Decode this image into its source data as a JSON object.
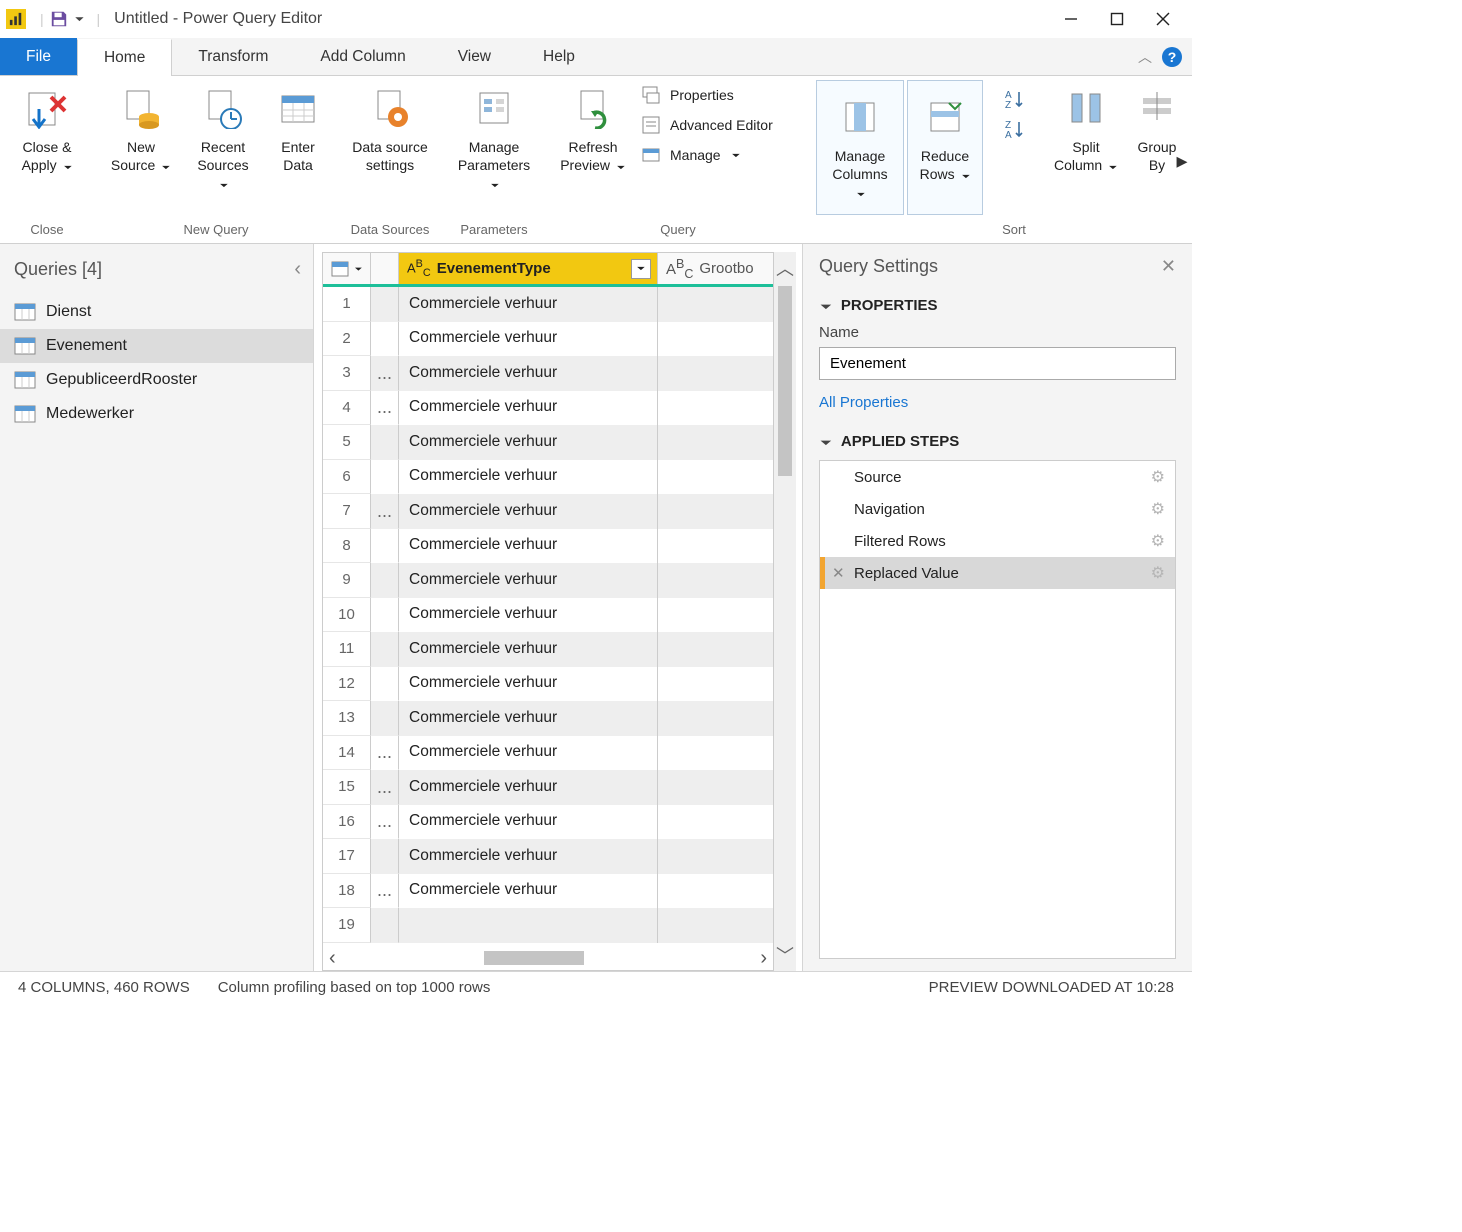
{
  "window_title": "Untitled - Power Query Editor",
  "ribbon_tabs": [
    "File",
    "Home",
    "Transform",
    "Add Column",
    "View",
    "Help"
  ],
  "ribbon": {
    "close_group": {
      "close_apply": "Close &\nApply",
      "group_label": "Close"
    },
    "new_query": {
      "new_source": "New\nSource",
      "recent": "Recent\nSources",
      "enter_data": "Enter\nData",
      "group_label": "New Query"
    },
    "data_sources": {
      "settings": "Data source\nsettings",
      "group_label": "Data Sources"
    },
    "parameters": {
      "manage": "Manage\nParameters",
      "group_label": "Parameters"
    },
    "query": {
      "refresh": "Refresh\nPreview",
      "properties": "Properties",
      "advanced": "Advanced Editor",
      "manage": "Manage",
      "group_label": "Query"
    },
    "columns": {
      "manage": "Manage\nColumns",
      "reduce": "Reduce\nRows"
    },
    "sort": {
      "group_label": "Sort"
    },
    "split": {
      "split": "Split\nColumn",
      "groupby": "Group\nBy"
    }
  },
  "queries_panel": {
    "header": "Queries [4]",
    "items": [
      "Dienst",
      "Evenement",
      "GepubliceerdRooster",
      "Medewerker"
    ],
    "selected_index": 1
  },
  "grid": {
    "column_selected": "EvenementType",
    "column_next": "Grootbo",
    "rows": [
      {
        "n": "1",
        "v": "Commerciele verhuur",
        "p": ""
      },
      {
        "n": "2",
        "v": "Commerciele verhuur",
        "p": ""
      },
      {
        "n": "3",
        "v": "Commerciele verhuur",
        "p": "..."
      },
      {
        "n": "4",
        "v": "Commerciele verhuur",
        "p": "..."
      },
      {
        "n": "5",
        "v": "Commerciele verhuur",
        "p": ""
      },
      {
        "n": "6",
        "v": "Commerciele verhuur",
        "p": ""
      },
      {
        "n": "7",
        "v": "Commerciele verhuur",
        "p": "..."
      },
      {
        "n": "8",
        "v": "Commerciele verhuur",
        "p": ""
      },
      {
        "n": "9",
        "v": "Commerciele verhuur",
        "p": ""
      },
      {
        "n": "10",
        "v": "Commerciele verhuur",
        "p": ""
      },
      {
        "n": "11",
        "v": "Commerciele verhuur",
        "p": ""
      },
      {
        "n": "12",
        "v": "Commerciele verhuur",
        "p": ""
      },
      {
        "n": "13",
        "v": "Commerciele verhuur",
        "p": ""
      },
      {
        "n": "14",
        "v": "Commerciele verhuur",
        "p": "..."
      },
      {
        "n": "15",
        "v": "Commerciele verhuur",
        "p": "..."
      },
      {
        "n": "16",
        "v": "Commerciele verhuur",
        "p": "..."
      },
      {
        "n": "17",
        "v": "Commerciele verhuur",
        "p": ""
      },
      {
        "n": "18",
        "v": "Commerciele verhuur",
        "p": "..."
      },
      {
        "n": "19",
        "v": "",
        "p": ""
      }
    ]
  },
  "settings": {
    "header": "Query Settings",
    "properties_title": "PROPERTIES",
    "name_label": "Name",
    "name_value": "Evenement",
    "all_props": "All Properties",
    "steps_title": "APPLIED STEPS",
    "steps": [
      {
        "label": "Source",
        "gear": true
      },
      {
        "label": "Navigation",
        "gear": true
      },
      {
        "label": "Filtered Rows",
        "gear": true
      },
      {
        "label": "Replaced Value",
        "gear": true,
        "selected": true
      }
    ]
  },
  "status": {
    "cols_rows": "4 COLUMNS, 460 ROWS",
    "profiling": "Column profiling based on top 1000 rows",
    "preview": "PREVIEW DOWNLOADED AT 10:28"
  }
}
